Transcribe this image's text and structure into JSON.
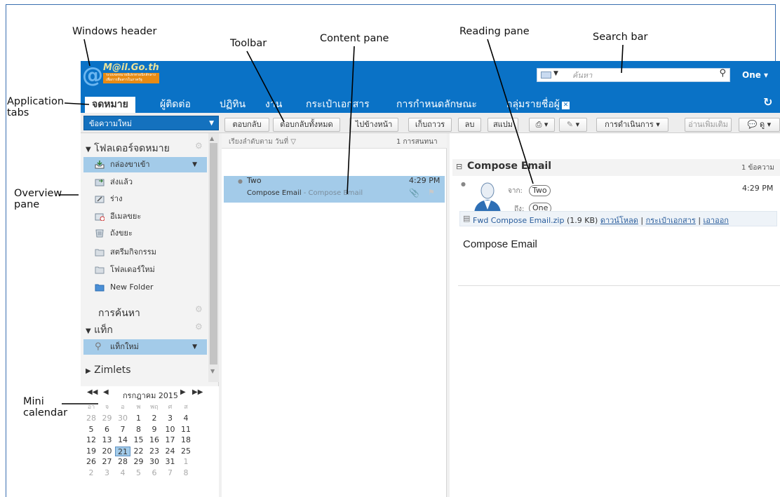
{
  "callouts": {
    "windows_header": "Windows header",
    "toolbar": "Toolbar",
    "content_pane": "Content pane",
    "reading_pane": "Reading pane",
    "search_bar": "Search bar",
    "application_tabs_line1": "Application",
    "application_tabs_line2": "tabs",
    "overview_line1": "Overview",
    "overview_line2": "pane",
    "mini_line1": "Mini",
    "mini_line2": "calendar"
  },
  "header": {
    "logo": "M@il.Go.th",
    "logo_sub": "ระบบจดหมายอิเล็กทรอนิกส์กลาง เพื่อการสื่อสารในภาครัฐ",
    "search_placeholder": "ค้นหา",
    "user": "One ▾"
  },
  "tabs": [
    {
      "label": "จดหมาย"
    },
    {
      "label": "ผู้ติดต่อ"
    },
    {
      "label": "ปฏิทิน"
    },
    {
      "label": "งาน"
    },
    {
      "label": "กระเป๋าเอกสาร"
    },
    {
      "label": "การกำหนดลักษณะ"
    },
    {
      "label": "กลุ่มรายชื่อผู้"
    }
  ],
  "toolbar": {
    "new_message": "ข้อความใหม่",
    "reply": "ตอบกลับ",
    "reply_all": "ตอบกลับทั้งหมด",
    "forward": "ไปข้างหน้า",
    "archive": "เก็บถาวร",
    "delete": "ลบ",
    "spam": "สแปม",
    "actions": "การดำเนินการ ▾",
    "read_more": "อ่านเพิ่มเติม",
    "view": "ดู ▾"
  },
  "overview": {
    "mail_folders": "โฟลเดอร์จดหมาย",
    "folders": [
      {
        "label": "กล่องขาเข้า"
      },
      {
        "label": "ส่งแล้ว"
      },
      {
        "label": "ร่าง"
      },
      {
        "label": "อีเมลขยะ"
      },
      {
        "label": "ถังขยะ"
      },
      {
        "label": "สตรีมกิจกรรม"
      },
      {
        "label": "โฟลเดอร์ใหม่"
      },
      {
        "label": "New Folder"
      }
    ],
    "searches": "การค้นหา",
    "tags": "แท็ก",
    "new_tag": "แท็กใหม่",
    "zimlets": "Zimlets"
  },
  "calendar": {
    "month": "กรกฎาคม 2015",
    "dow": [
      "อา",
      "จ",
      "อ",
      "พ",
      "พฤ",
      "ศ",
      "ส"
    ],
    "weeks": [
      [
        "28",
        "29",
        "30",
        "1",
        "2",
        "3",
        "4"
      ],
      [
        "5",
        "6",
        "7",
        "8",
        "9",
        "10",
        "11"
      ],
      [
        "12",
        "13",
        "14",
        "15",
        "16",
        "17",
        "18"
      ],
      [
        "19",
        "20",
        "21",
        "22",
        "23",
        "24",
        "25"
      ],
      [
        "26",
        "27",
        "28",
        "29",
        "30",
        "31",
        "1"
      ],
      [
        "2",
        "3",
        "4",
        "5",
        "6",
        "7",
        "8"
      ]
    ]
  },
  "content": {
    "sort_label": "เรียงลำดับตาม วันที่ ▽",
    "conv_count": "1 การสนทนา",
    "message": {
      "from": "Two",
      "time": "4:29 PM",
      "subject": "Compose Email",
      "fragment": " - Compose Email"
    }
  },
  "reading": {
    "subject": "Compose Email",
    "count": "1 ข้อความ",
    "from_label": "จาก:",
    "from": "Two",
    "to_label": "ถึง:",
    "to": "One",
    "time": "4:29 PM",
    "attachment": "Fwd Compose Email.zip",
    "attachment_size": "(1.9 KB)",
    "download": "ดาวน์โหลด",
    "briefcase": "กระเป๋าเอกสาร",
    "remove": "เอาออก",
    "body": "Compose Email"
  }
}
